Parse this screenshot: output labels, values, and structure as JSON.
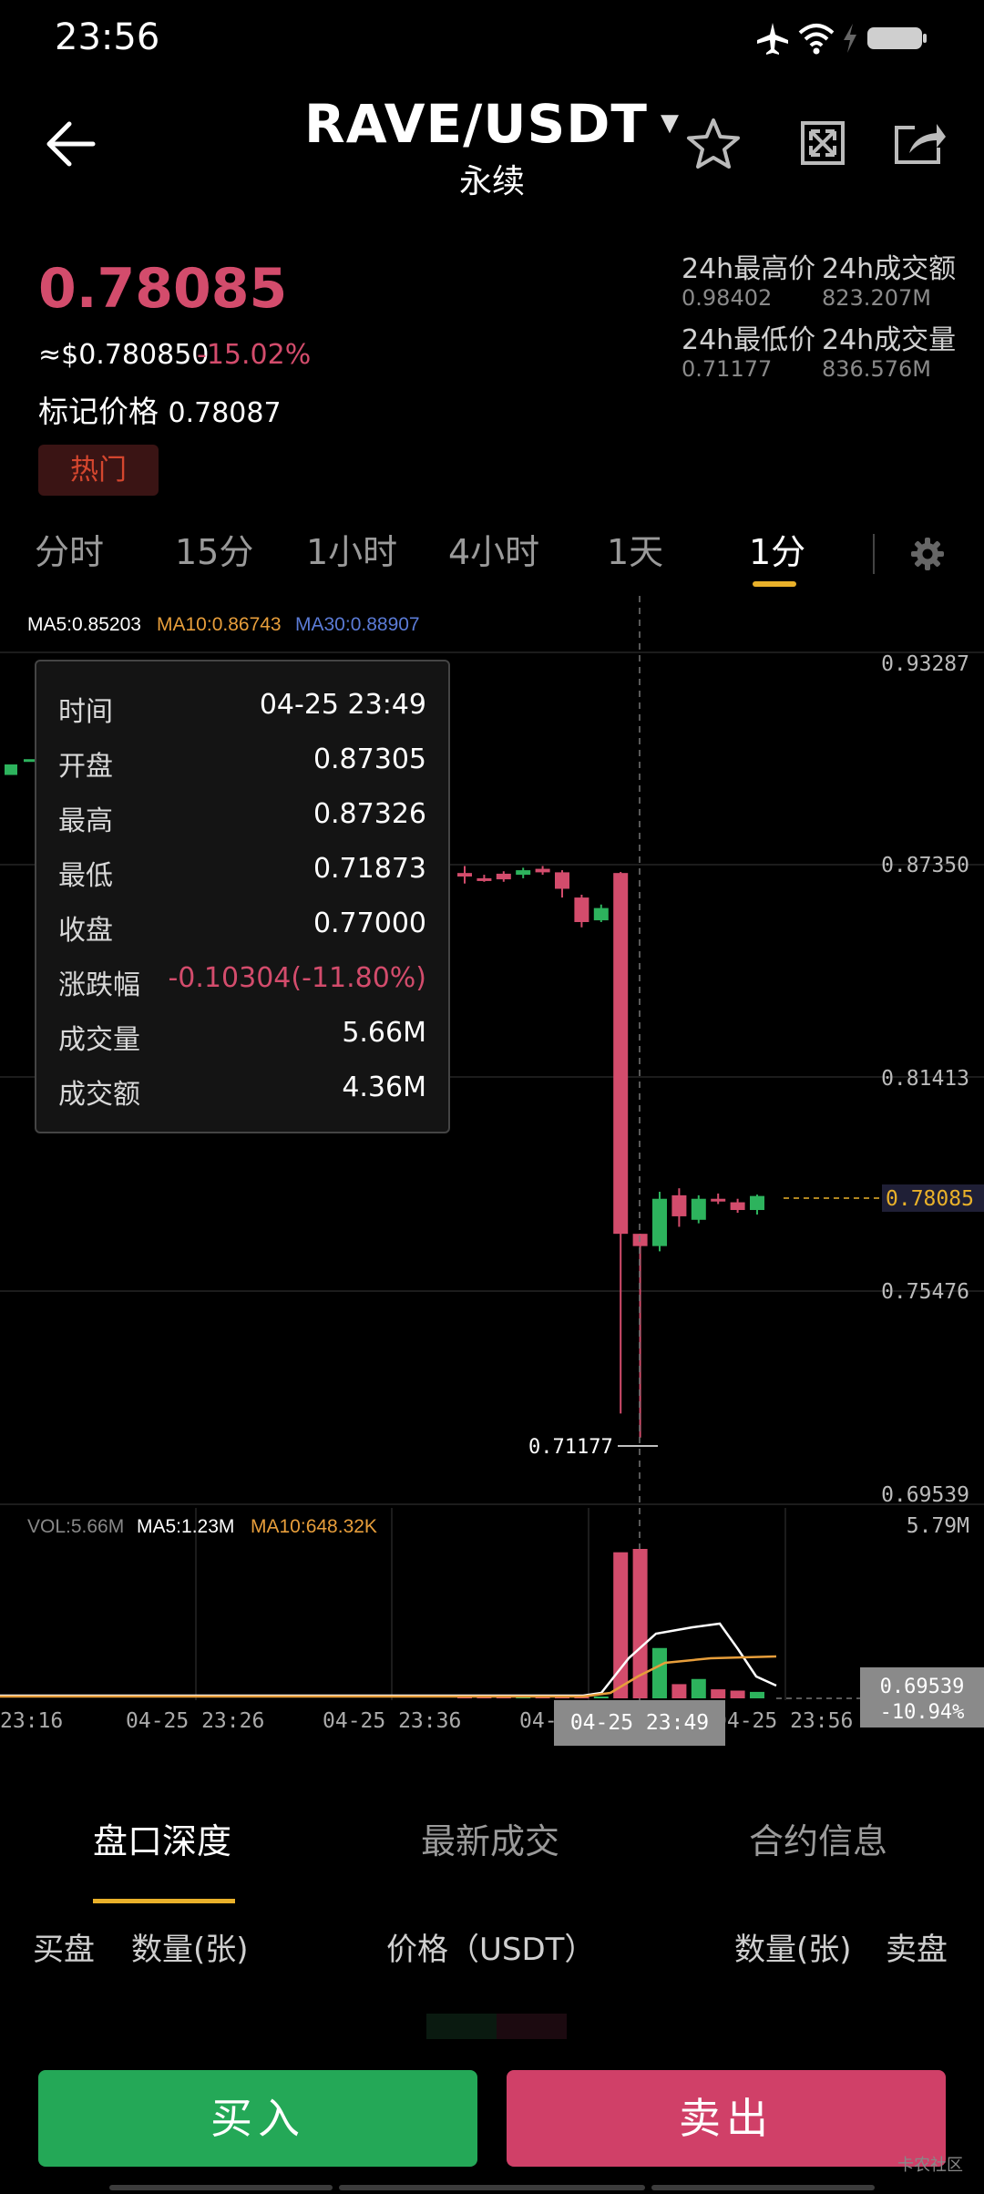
{
  "status_bar": {
    "time": "23:56"
  },
  "header": {
    "title": "RAVE/USDT",
    "subtitle": "永续"
  },
  "price": {
    "last": "0.78085",
    "usd": "≈$0.780850",
    "change": "-15.02%",
    "mark_label": "标记价格",
    "mark_value": "0.78087",
    "tag": "热门"
  },
  "stats": {
    "high_label": "24h最高价",
    "high_value": "0.98402",
    "amount_label": "24h成交额",
    "amount_value": "823.207M",
    "low_label": "24h最低价",
    "low_value": "0.71177",
    "volume_label": "24h成交量",
    "volume_value": "836.576M"
  },
  "intervals": [
    "分时",
    "15分",
    "1小时",
    "4小时",
    "1天",
    "1分"
  ],
  "ma": {
    "ma5": "MA5:0.85203",
    "ma10": "MA10:0.86743",
    "ma30": "MA30:0.88907"
  },
  "colors": {
    "up": "#2db35d",
    "down": "#d34c6c",
    "accent": "#e9b12a",
    "ma10": "#e79e3b",
    "ma30": "#5b7bd6"
  },
  "price_axis": [
    "0.93287",
    "0.87350",
    "0.81413",
    "0.78085",
    "0.75476",
    "0.69539"
  ],
  "low_marker": "0.71177",
  "volume": {
    "label": "VOL:5.66M",
    "ma5": "MA5:1.23M",
    "ma10": "MA10:648.32K",
    "axis_top": "5.79M",
    "cursor_price": "0.69539",
    "cursor_pct": "-10.94%"
  },
  "time_axis": [
    "23:16",
    "04-25 23:26",
    "04-25 23:36",
    "04-",
    "04-25 23:56"
  ],
  "crosshair_time": "04-25 23:49",
  "tooltip": [
    {
      "k": "时间",
      "v": "04-25 23:49"
    },
    {
      "k": "开盘",
      "v": "0.87305"
    },
    {
      "k": "最高",
      "v": "0.87326"
    },
    {
      "k": "最低",
      "v": "0.71873"
    },
    {
      "k": "收盘",
      "v": "0.77000"
    },
    {
      "k": "涨跌幅",
      "v": "-0.10304(-11.80%)"
    },
    {
      "k": "成交量",
      "v": "5.66M"
    },
    {
      "k": "成交额",
      "v": "4.36M"
    }
  ],
  "bottom_tabs": [
    "盘口深度",
    "最新成交",
    "合约信息"
  ],
  "columns": {
    "buy": "买盘",
    "qty_left": "数量(张)",
    "price": "价格（USDT）",
    "qty_right": "数量(张)",
    "sell": "卖盘"
  },
  "buttons": {
    "buy": "买入",
    "sell": "卖出"
  },
  "watermark": "卡农社区",
  "chart_data": {
    "type": "candlestick",
    "interval": "1分",
    "candles": [
      {
        "o": 0.873,
        "h": 0.875,
        "l": 0.87,
        "c": 0.872,
        "dir": "down"
      },
      {
        "o": 0.8715,
        "h": 0.8725,
        "l": 0.8705,
        "c": 0.8712,
        "dir": "down"
      },
      {
        "o": 0.8712,
        "h": 0.8735,
        "l": 0.8705,
        "c": 0.8728,
        "dir": "down"
      },
      {
        "o": 0.8725,
        "h": 0.8745,
        "l": 0.8715,
        "c": 0.8738,
        "dir": "up"
      },
      {
        "o": 0.8742,
        "h": 0.875,
        "l": 0.8725,
        "c": 0.8732,
        "dir": "down"
      },
      {
        "o": 0.8732,
        "h": 0.8738,
        "l": 0.866,
        "c": 0.8685,
        "dir": "down"
      },
      {
        "o": 0.866,
        "h": 0.8668,
        "l": 0.8575,
        "c": 0.859,
        "dir": "down"
      },
      {
        "o": 0.8595,
        "h": 0.864,
        "l": 0.859,
        "c": 0.863,
        "dir": "up"
      },
      {
        "o": 0.873,
        "h": 0.8733,
        "l": 0.7187,
        "c": 0.77,
        "dir": "down"
      },
      {
        "o": 0.77,
        "h": 0.77,
        "l": 0.7118,
        "c": 0.7665,
        "dir": "down"
      },
      {
        "o": 0.7665,
        "h": 0.782,
        "l": 0.765,
        "c": 0.78,
        "dir": "up"
      },
      {
        "o": 0.781,
        "h": 0.783,
        "l": 0.772,
        "c": 0.775,
        "dir": "down"
      },
      {
        "o": 0.774,
        "h": 0.781,
        "l": 0.773,
        "c": 0.78,
        "dir": "up"
      },
      {
        "o": 0.78,
        "h": 0.7815,
        "l": 0.7785,
        "c": 0.7795,
        "dir": "down"
      },
      {
        "o": 0.779,
        "h": 0.78,
        "l": 0.776,
        "c": 0.7768,
        "dir": "down"
      },
      {
        "o": 0.7768,
        "h": 0.7812,
        "l": 0.7755,
        "c": 0.7808,
        "dir": "up"
      }
    ],
    "price_range": [
      0.69539,
      0.93287
    ],
    "volume_range": [
      0,
      5.79
    ]
  }
}
